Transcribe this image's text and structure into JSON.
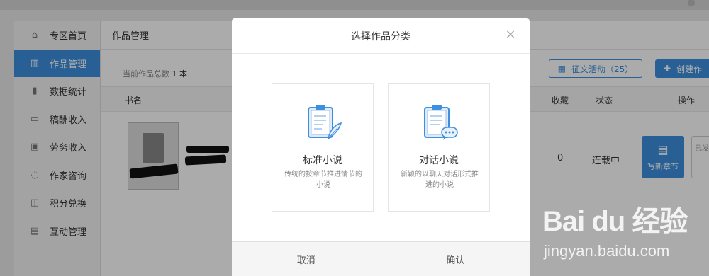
{
  "sidebar": {
    "items": [
      {
        "label": "专区首页",
        "icon": "home-icon",
        "glyph": "⌂",
        "active": false
      },
      {
        "label": "作品管理",
        "icon": "book-icon",
        "glyph": "▥",
        "active": true
      },
      {
        "label": "数据统计",
        "icon": "bar-chart-icon",
        "glyph": "▮",
        "active": false
      },
      {
        "label": "稿酬收入",
        "icon": "wallet-icon",
        "glyph": "▭",
        "active": false
      },
      {
        "label": "劳务收入",
        "icon": "money-icon",
        "glyph": "▣",
        "active": false
      },
      {
        "label": "作家咨询",
        "icon": "chat-icon",
        "glyph": "◌",
        "active": false
      },
      {
        "label": "积分兑换",
        "icon": "bag-icon",
        "glyph": "◫",
        "active": false
      },
      {
        "label": "互动管理",
        "icon": "comments-icon",
        "glyph": "▤",
        "active": false
      }
    ]
  },
  "main": {
    "header_title": "作品管理",
    "count_label": "当前作品总数",
    "count_value": "1 本",
    "contest_button": "征文活动（25）",
    "create_button": "创建作",
    "table_headers": {
      "name": "书名",
      "favorites": "收藏",
      "status": "状态",
      "actions": "操作"
    },
    "row": {
      "favorites": "0",
      "status": "连载中",
      "write_button": "写新章节",
      "sent_button": "已发"
    }
  },
  "modal": {
    "title": "选择作品分类",
    "close_glyph": "×",
    "cards": [
      {
        "title": "标准小说",
        "desc": "传统的按章节推进情节的小说",
        "icon": "feather-document-icon"
      },
      {
        "title": "对话小说",
        "desc": "新颖的以聊天对话形式推进的小说",
        "icon": "chat-document-icon"
      }
    ],
    "cancel_button": "取消",
    "confirm_button": "确认"
  },
  "watermark": {
    "logo": "Bai du 经验",
    "url": "jingyan.baidu.com"
  },
  "colors": {
    "accent": "#3d8fe0",
    "overlay": "rgba(0,0,0,0.33)"
  }
}
